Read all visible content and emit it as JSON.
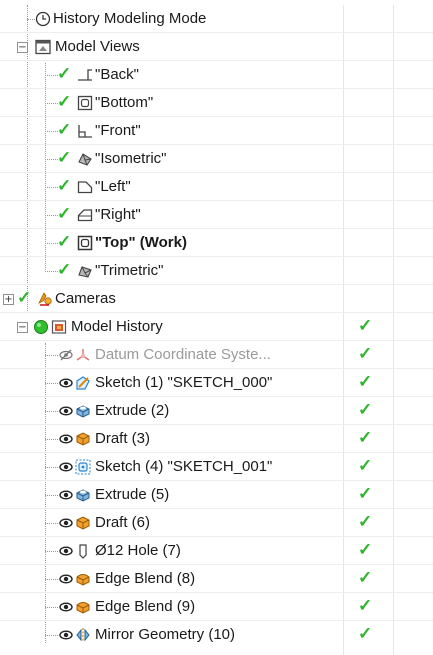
{
  "tree": {
    "history_mode": {
      "label": "History Modeling Mode",
      "icon": "clock-icon"
    },
    "model_views": {
      "label": "Model Views",
      "toggle": "−",
      "icon": "model-views-icon",
      "items": [
        {
          "label": "\"Back\"",
          "icon": "view-back-icon",
          "bold": false
        },
        {
          "label": "\"Bottom\"",
          "icon": "view-bottom-icon",
          "bold": false
        },
        {
          "label": "\"Front\"",
          "icon": "view-front-icon",
          "bold": false
        },
        {
          "label": "\"Isometric\"",
          "icon": "view-isometric-icon",
          "bold": false
        },
        {
          "label": "\"Left\"",
          "icon": "view-left-icon",
          "bold": false
        },
        {
          "label": "\"Right\"",
          "icon": "view-right-icon",
          "bold": false
        },
        {
          "label": "\"Top\" (Work)",
          "icon": "view-top-icon",
          "bold": true
        },
        {
          "label": "\"Trimetric\"",
          "icon": "view-trimetric-icon",
          "bold": false
        }
      ]
    },
    "cameras": {
      "label": "Cameras",
      "toggle": "+",
      "icon": "camera-icon"
    },
    "model_history": {
      "label": "Model History",
      "toggle": "−",
      "icon": "model-history-icon",
      "status_icon": "green-status-icon",
      "items": [
        {
          "label": "Datum Coordinate Syste...",
          "icon": "datum-csys-icon",
          "visible": false,
          "greyed": true
        },
        {
          "label": "Sketch (1) \"SKETCH_000\"",
          "icon": "sketch-icon",
          "visible": true,
          "greyed": false
        },
        {
          "label": "Extrude (2)",
          "icon": "extrude-icon",
          "visible": true,
          "greyed": false
        },
        {
          "label": "Draft (3)",
          "icon": "draft-icon",
          "visible": true,
          "greyed": false
        },
        {
          "label": "Sketch (4) \"SKETCH_001\"",
          "icon": "sketch-selected-icon",
          "visible": true,
          "greyed": false
        },
        {
          "label": "Extrude (5)",
          "icon": "extrude-icon",
          "visible": true,
          "greyed": false
        },
        {
          "label": "Draft (6)",
          "icon": "draft-icon",
          "visible": true,
          "greyed": false
        },
        {
          "label": "Ø12 Hole (7)",
          "icon": "hole-icon",
          "visible": true,
          "greyed": false
        },
        {
          "label": "Edge Blend (8)",
          "icon": "edge-blend-icon",
          "visible": true,
          "greyed": false
        },
        {
          "label": "Edge Blend (9)",
          "icon": "edge-blend-icon",
          "visible": true,
          "greyed": false
        },
        {
          "label": "Mirror Geometry (10)",
          "icon": "mirror-geometry-icon",
          "visible": true,
          "greyed": false
        }
      ]
    },
    "check_glyph": "✓",
    "colors": {
      "check": "#2db52d",
      "greyed_text": "#9a9a9a",
      "grid": "#e6e6e6"
    }
  }
}
